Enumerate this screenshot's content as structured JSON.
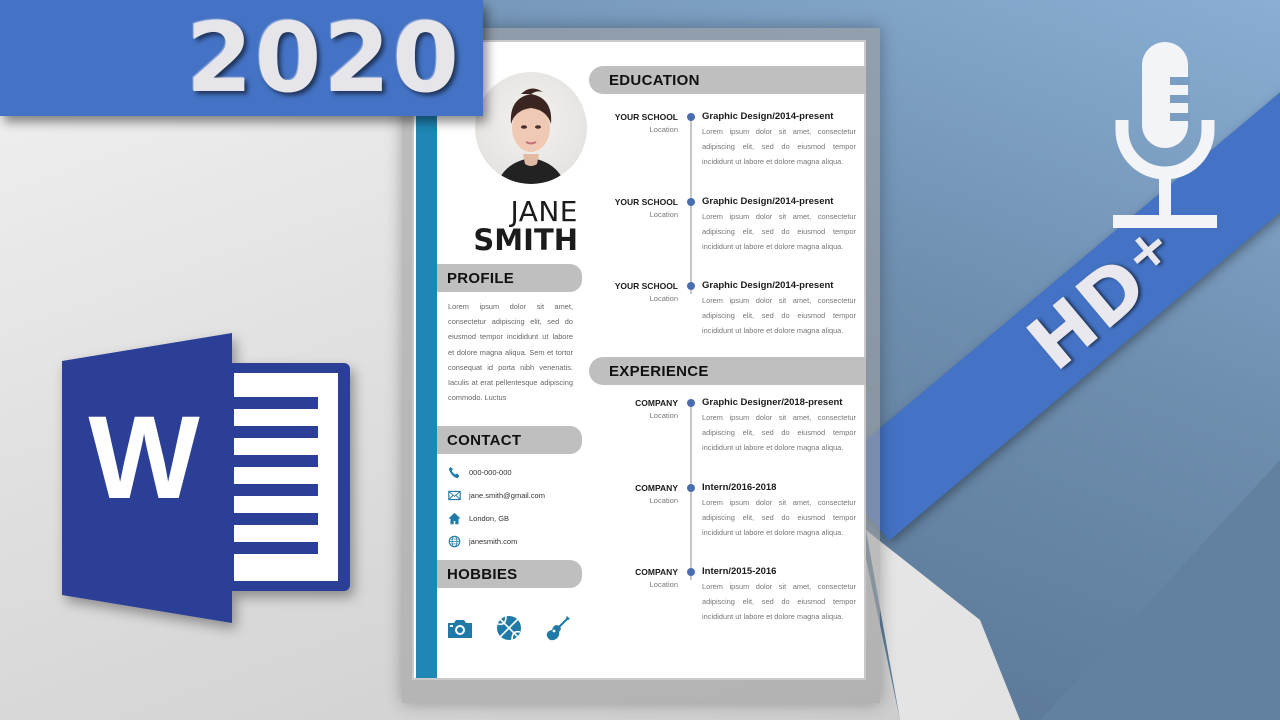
{
  "banner": {
    "year": "2020",
    "badge": "HD",
    "badge_sup": "+"
  },
  "colors": {
    "accent_blue": "#4472c4",
    "word_blue": "#2b3f96",
    "resume_sidebar": "#1f86b5",
    "section_header_bg": "#bfbfbf",
    "timeline_dot": "#4a6db0",
    "icon_teal": "#1f7aa8"
  },
  "icons": {
    "word_logo": "microsoft-word-logo-icon",
    "mic": "microphone-icon",
    "phone": "phone-icon",
    "email": "envelope-icon",
    "home": "home-icon",
    "web": "globe-icon",
    "hobby_photo": "camera-icon",
    "hobby_ball": "basketball-icon",
    "hobby_music": "guitar-icon"
  },
  "resume": {
    "first_name": "JANE",
    "last_name": "SMITH",
    "profile": {
      "heading": "PROFILE",
      "text": "Lorem ipsum dolor sit amet, consectetur adipiscing elit, sed do eiusmod tempor incididunt ut labore et dolore magna aliqua. Sem et tortor consequat id porta nibh venenatis. Iaculis at erat pellentesque adipiscing commodo. Luctus"
    },
    "contact": {
      "heading": "CONTACT",
      "phone": "000-000-000",
      "email": "jane.smith@gmail.com",
      "address": "London, GB",
      "website": "janesmith.com"
    },
    "hobbies": {
      "heading": "HOBBIES"
    },
    "education": {
      "heading": "EDUCATION",
      "entries": [
        {
          "org": "YOUR SCHOOL",
          "location": "Location",
          "title": "Graphic Design/2014-present",
          "desc_main": "Lorem ipsum dolor sit amet, consectetur adipiscing elit, sed do eiusmod tempor",
          "desc_last": "incididunt ut labore et dolore magna aliqua."
        },
        {
          "org": "YOUR SCHOOL",
          "location": "Location",
          "title": "Graphic Design/2014-present",
          "desc_main": "Lorem ipsum dolor sit amet, consectetur adipiscing elit, sed do eiusmod tempor",
          "desc_last": "incididunt ut labore et dolore magna aliqua."
        },
        {
          "org": "YOUR SCHOOL",
          "location": "Location",
          "title": "Graphic Design/2014-present",
          "desc_main": "Lorem ipsum dolor sit amet, consectetur adipiscing elit, sed do eiusmod tempor",
          "desc_last": "incididunt ut labore et dolore magna aliqua."
        }
      ]
    },
    "experience": {
      "heading": "EXPERIENCE",
      "entries": [
        {
          "org": "COMPANY",
          "location": "Location",
          "title": "Graphic Designer/2018-present",
          "desc_main": "Lorem ipsum dolor sit amet, consectetur adipiscing elit, sed do eiusmod tempor",
          "desc_last": "incididunt ut labore et dolore magna aliqua."
        },
        {
          "org": "COMPANY",
          "location": "Location",
          "title": "Intern/2016-2018",
          "desc_main": "Lorem ipsum dolor sit amet, consectetur adipiscing elit, sed do eiusmod tempor",
          "desc_last": "incididunt ut labore et dolore magna aliqua."
        },
        {
          "org": "COMPANY",
          "location": "Location",
          "title": "Intern/2015-2016",
          "desc_main": "Lorem ipsum dolor sit amet, consectetur adipiscing elit, sed do eiusmod tempor",
          "desc_last": "incididunt ut labore et dolore magna aliqua."
        }
      ]
    }
  }
}
